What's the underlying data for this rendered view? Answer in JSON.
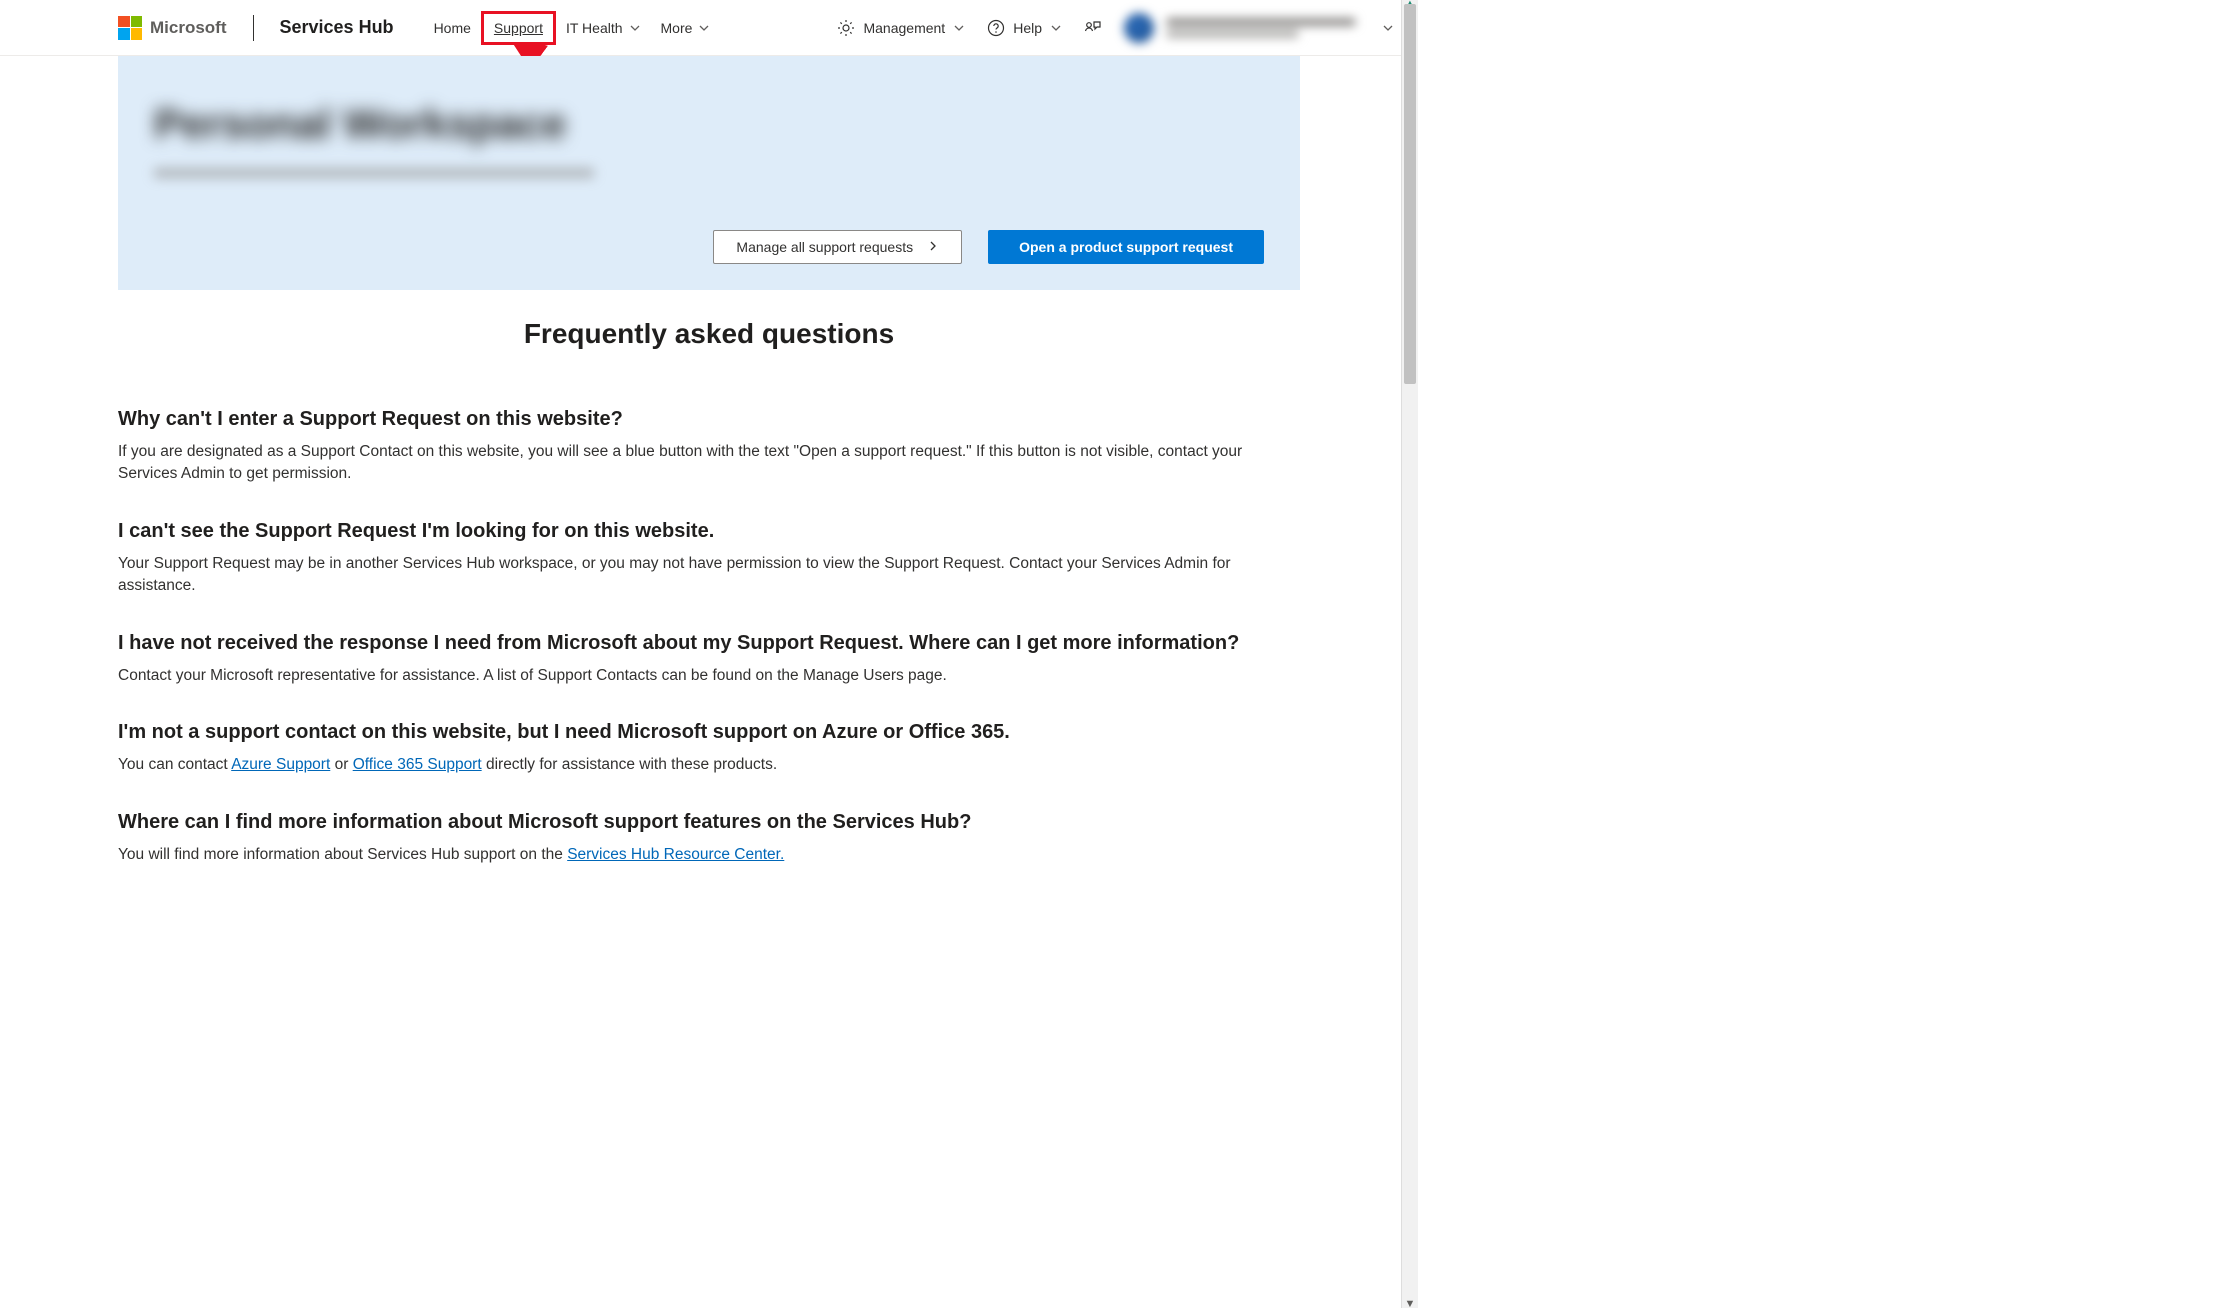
{
  "brand": {
    "logo_text": "Microsoft",
    "product": "Services Hub"
  },
  "nav": {
    "home": "Home",
    "support": "Support",
    "it_health": "IT Health",
    "more": "More",
    "management": "Management",
    "help": "Help"
  },
  "hero": {
    "title_blurred": "Personal Workspace",
    "subtitle_blurred": "Quickly open and manage your Microsoft support requests",
    "manage_btn": "Manage all support requests",
    "open_btn": "Open a product support request"
  },
  "faq": {
    "heading": "Frequently asked questions",
    "items": [
      {
        "q": "Why can't I enter a Support Request on this website?",
        "a_pre": "If you are designated as a Support Contact on this website, you will see a blue button with the text \"Open a support request.\" If this button is not visible, contact your Services Admin to get permission."
      },
      {
        "q": "I can't see the Support Request I'm looking for on this website.",
        "a_pre": "Your Support Request may be in another Services Hub workspace, or you may not have permission to view the Support Request. Contact your Services Admin for assistance."
      },
      {
        "q": "I have not received the response I need from Microsoft about my Support Request. Where can I get more information?",
        "a_pre": "Contact your Microsoft representative for assistance. A list of Support Contacts can be found on the Manage Users page."
      },
      {
        "q": "I'm not a support contact on this website, but I need Microsoft support on Azure or Office 365.",
        "a_pre": "You can contact ",
        "link1": "Azure Support",
        "mid": " or ",
        "link2": "Office 365 Support",
        "a_post": " directly for assistance with these products."
      },
      {
        "q": "Where can I find more information about Microsoft support features on the Services Hub?",
        "a_pre": "You will find more information about Services Hub support on the ",
        "link1": "Services Hub Resource Center."
      }
    ]
  }
}
